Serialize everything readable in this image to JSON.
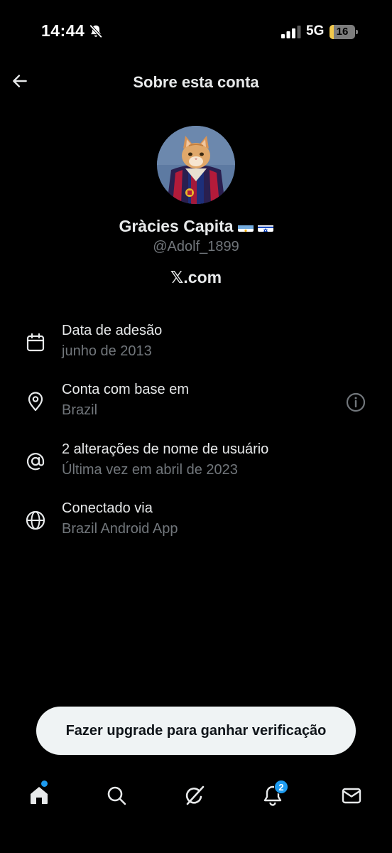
{
  "status_bar": {
    "time": "14:44",
    "network": "5G",
    "battery": "16",
    "battery_level": 0.16
  },
  "header": {
    "title": "Sobre esta conta"
  },
  "profile": {
    "display_name": "Gràcies Capita",
    "flags": [
      "argentina-flag",
      "israel-flag"
    ],
    "handle": "@Adolf_1899",
    "domain": "𝕏.com"
  },
  "info_rows": [
    {
      "icon": "calendar-icon",
      "title": "Data de adesão",
      "subtitle": "junho de 2013"
    },
    {
      "icon": "location-pin-icon",
      "title": "Conta com base em",
      "subtitle": "Brazil"
    },
    {
      "icon": "at-sign-icon",
      "title": "2 alterações de nome de usuário",
      "subtitle": "Última vez em abril de 2023"
    },
    {
      "icon": "globe-icon",
      "title": "Conectado via",
      "subtitle": "Brazil Android App"
    }
  ],
  "upgrade_button": {
    "label": "Fazer upgrade para ganhar verificação"
  },
  "bottom_nav": {
    "items": [
      "home-icon",
      "search-icon",
      "grok-icon",
      "notifications-icon",
      "messages-icon"
    ],
    "notifications_badge": "2"
  },
  "colors": {
    "background": "#000000",
    "primary_text": "#e7e9ea",
    "secondary_text": "#71767b",
    "accent": "#1d9bf0",
    "pill_background": "#eff3f4"
  }
}
